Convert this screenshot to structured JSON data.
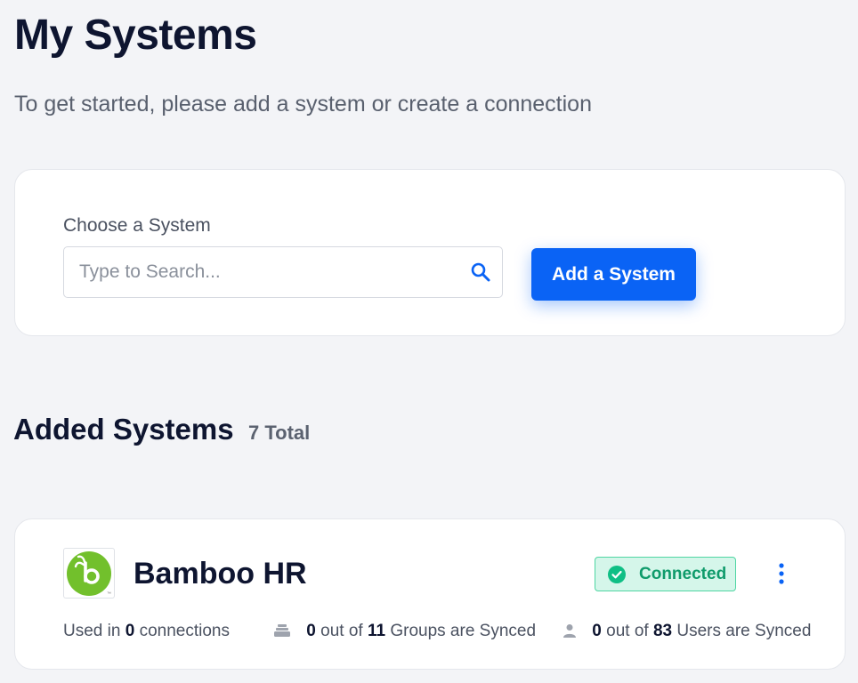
{
  "header": {
    "title": "My Systems",
    "subtitle": "To get started, please add a system or create a connection"
  },
  "choose_system": {
    "label": "Choose a System",
    "search_placeholder": "Type to Search...",
    "search_value": "",
    "add_button_label": "Add a System",
    "accent_color": "#0a63f5"
  },
  "added_systems": {
    "heading": "Added Systems",
    "total_label": "7 Total",
    "items": [
      {
        "name": "Bamboo HR",
        "logo_icon": "bamboohr-logo",
        "status": "Connected",
        "status_color": "#0f9b6b",
        "menu_icon": "more-vertical-icon",
        "connections": {
          "prefix": "Used in",
          "count": "0",
          "suffix": "connections"
        },
        "groups": {
          "icon": "stack-icon",
          "synced": "0",
          "middle": "out of",
          "total": "11",
          "suffix": "Groups are Synced"
        },
        "users": {
          "icon": "user-icon",
          "synced": "0",
          "middle": "out of",
          "total": "83",
          "suffix": "Users are Synced"
        }
      }
    ]
  }
}
